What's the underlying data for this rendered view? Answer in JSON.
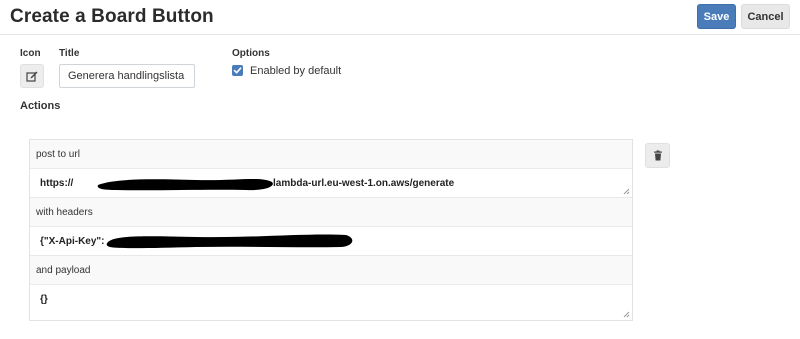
{
  "header": {
    "title": "Create a Board Button",
    "save_label": "Save",
    "cancel_label": "Cancel"
  },
  "form": {
    "icon_label": "Icon",
    "icon_name": "edit-icon",
    "title_label": "Title",
    "title_value": "Generera handlingslista",
    "options_label": "Options",
    "enabled_label": "Enabled by default",
    "enabled_checked": true,
    "actions_label": "Actions"
  },
  "action": {
    "post_label": "post to url",
    "url_prefix": "https://",
    "url_suffix": "lambda-url.eu-west-1.on.aws/generate",
    "headers_label": "with headers",
    "headers_value": "{\"X-Api-Key\":",
    "payload_label": "and payload",
    "payload_value": "{}"
  },
  "colors": {
    "primary": "#4a7cba",
    "redaction": "#000000"
  }
}
